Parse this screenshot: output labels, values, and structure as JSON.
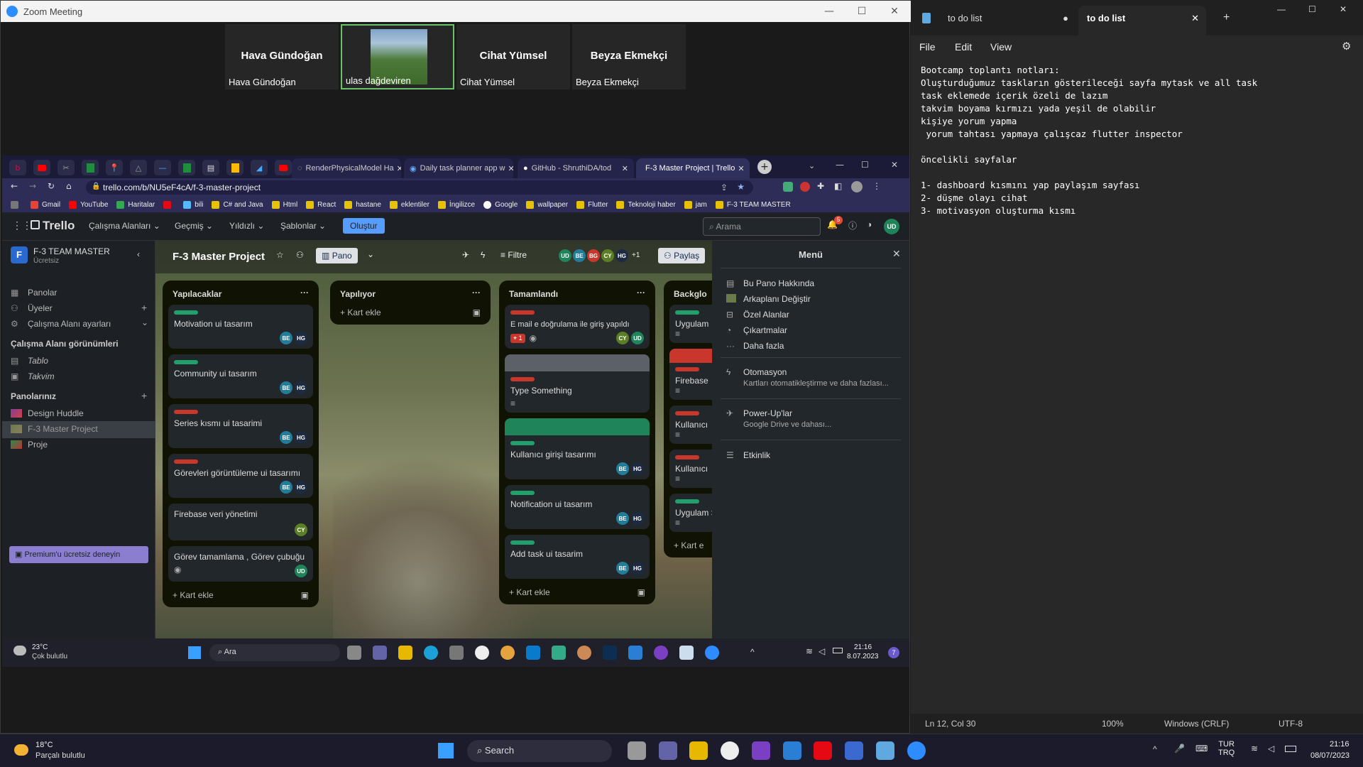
{
  "zoom": {
    "title": "Zoom Meeting",
    "participants": [
      {
        "name": "Hava Gündoğan",
        "label": "Hava Gündoğan"
      },
      {
        "name": "",
        "label": "ulas dağdeviren"
      },
      {
        "name": "Cihat Yümsel",
        "label": "Cihat Yümsel"
      },
      {
        "name": "Beyza Ekmekçi",
        "label": "Beyza Ekmekçi"
      }
    ]
  },
  "browser": {
    "tabs": [
      "RenderPhysicalModel Ha",
      "Daily task planner app w",
      "GitHub - ShruthiDA/tod",
      "F-3 Master Project | Trello"
    ],
    "url": "trello.com/b/NU5eF4cA/f-3-master-project",
    "bookmarks": [
      "Gmail",
      "YouTube",
      "Haritalar",
      "",
      "bili",
      "C# and Java",
      "Html",
      "React",
      "hastane",
      "eklentiler",
      "İngilizce",
      "Google",
      "wallpaper",
      "Flutter",
      "Teknoloji haber",
      "jam",
      "F-3 TEAM MASTER"
    ]
  },
  "trello": {
    "logo": "Trello",
    "nav": [
      "Çalışma Alanları",
      "Geçmiş",
      "Yıldızlı",
      "Şablonlar"
    ],
    "create": "Oluştur",
    "search": "Arama",
    "workspace": {
      "name": "F-3 TEAM MASTER",
      "plan": "Ücretsiz",
      "initial": "F"
    },
    "sidebar": {
      "items": [
        "Panolar",
        "Üyeler",
        "Çalışma Alanı ayarları"
      ],
      "views_title": "Çalışma Alanı görünümleri",
      "views": [
        "Tablo",
        "Takvim"
      ],
      "boards_title": "Panolarınız",
      "boards": [
        "Design Huddle",
        "F-3 Master Project",
        "Proje"
      ],
      "premium": "Premium'u ücretsiz deneyin"
    },
    "board": {
      "title": "F-3 Master Project",
      "view": "Pano",
      "filter": "Filtre",
      "members": [
        "UD",
        "BE",
        "BG",
        "CY",
        "HG"
      ],
      "more": "+1",
      "share": "Paylaş"
    },
    "lists": [
      {
        "title": "Yapılacaklar",
        "cards": [
          {
            "text": "Motivation ui tasarım",
            "label": "#22a06b",
            "avatars": [
              "BE",
              "HG"
            ]
          },
          {
            "text": "Community ui tasarım",
            "label": "#22a06b",
            "avatars": [
              "BE",
              "HG"
            ]
          },
          {
            "text": "Series kısmı ui tasarimi",
            "label": "#c9372c",
            "avatars": [
              "BE",
              "HG"
            ]
          },
          {
            "text": "Görevleri görüntüleme ui tasarımı",
            "label": "#c9372c",
            "avatars": [
              "BE",
              "HG"
            ]
          },
          {
            "text": "Firebase veri yönetimi",
            "label": "",
            "avatars": [
              "CY"
            ]
          },
          {
            "text": "Görev tamamlama , Görev çubuğu",
            "label": "",
            "avatars": [
              "UD"
            ]
          }
        ],
        "add": "Kart ekle"
      },
      {
        "title": "Yapılıyor",
        "cards": [],
        "add": "Kart ekle"
      },
      {
        "title": "Tamamlandı",
        "cards": [
          {
            "text": "E mail e doğrulama ile giriş yapıldı",
            "label": "#c9372c",
            "avatars": [
              "CY",
              "UD"
            ],
            "badge": "1"
          },
          {
            "text": "Type Something",
            "label": "#c9372c",
            "avatars": [],
            "cover": "#5c6168"
          },
          {
            "text": "Kullanıcı girişi tasarımı",
            "label": "#22a06b",
            "avatars": [
              "BE",
              "HG"
            ],
            "cover": "#1f845a"
          },
          {
            "text": "Notification ui tasarım",
            "label": "#22a06b",
            "avatars": [
              "BE",
              "HG"
            ]
          },
          {
            "text": "Add task ui tasarim",
            "label": "#22a06b",
            "avatars": [
              "BE",
              "HG"
            ]
          }
        ],
        "add": "Kart ekle"
      },
      {
        "title": "Backglo",
        "cards": [
          {
            "text": "Uygulam",
            "label": "#22a06b",
            "avatars": []
          },
          {
            "text": "Firebase",
            "label": "#c9372c",
            "avatars": []
          },
          {
            "text": "Kullanıcı",
            "label": "#c9372c",
            "avatars": []
          },
          {
            "text": "Kullanıcı",
            "label": "#c9372c",
            "avatars": []
          },
          {
            "text": "Uygulam Sayfaları",
            "label": "#22a06b",
            "avatars": []
          }
        ],
        "add": "Kart e"
      }
    ],
    "menu": {
      "title": "Menü",
      "items": [
        "Bu Pano Hakkında",
        "Arkaplanı Değiştir",
        "Özel Alanlar",
        "Çıkartmalar",
        "Daha fazla"
      ],
      "automation": "Otomasyon",
      "automation_sub": "Kartları otomatikleştirme ve daha fazlası...",
      "powerups": "Power-Up'lar",
      "powerups_sub": "Google Drive ve dahası...",
      "activity": "Etkinlik"
    },
    "notif": "5"
  },
  "inner_taskbar": {
    "temp": "23°C",
    "weather": "Çok bulutlu",
    "search": "Ara",
    "time": "21:16",
    "date": "8.07.2023",
    "badge": "7"
  },
  "notepad": {
    "tabs": [
      "to do list",
      "to do list"
    ],
    "menu": [
      "File",
      "Edit",
      "View"
    ],
    "text": "Bootcamp toplantı notları:\nOluşturduğumuz taskların gösterileceği sayfa mytask ve all task\ntask eklemede içerik özeli de lazım\ntakvim boyama kırmızı yada yeşil de olabilir\nkişiye yorum yapma\n yorum tahtası yapmaya çalışcaz flutter inspector\n\nöncelikli sayfalar\n\n1- dashboard kısmını yap paylaşım sayfası\n2- düşme olayı cihat\n3- motivasyon oluşturma kısmı",
    "status": {
      "position": "Ln 12, Col 30",
      "zoom": "100%",
      "eol": "Windows (CRLF)",
      "encoding": "UTF-8"
    }
  },
  "taskbar": {
    "temp": "18°C",
    "weather": "Parçalı bulutlu",
    "search": "Search",
    "lang1": "TUR",
    "lang2": "TRQ",
    "time": "21:16",
    "date": "08/07/2023"
  },
  "colors": {
    "avatar_UD": "#1f845a",
    "avatar_BE": "#227d9b",
    "avatar_BG": "#c9372c",
    "avatar_CY": "#5b7f24",
    "avatar_HG": "#1c2b41",
    "create": "#579dff"
  }
}
